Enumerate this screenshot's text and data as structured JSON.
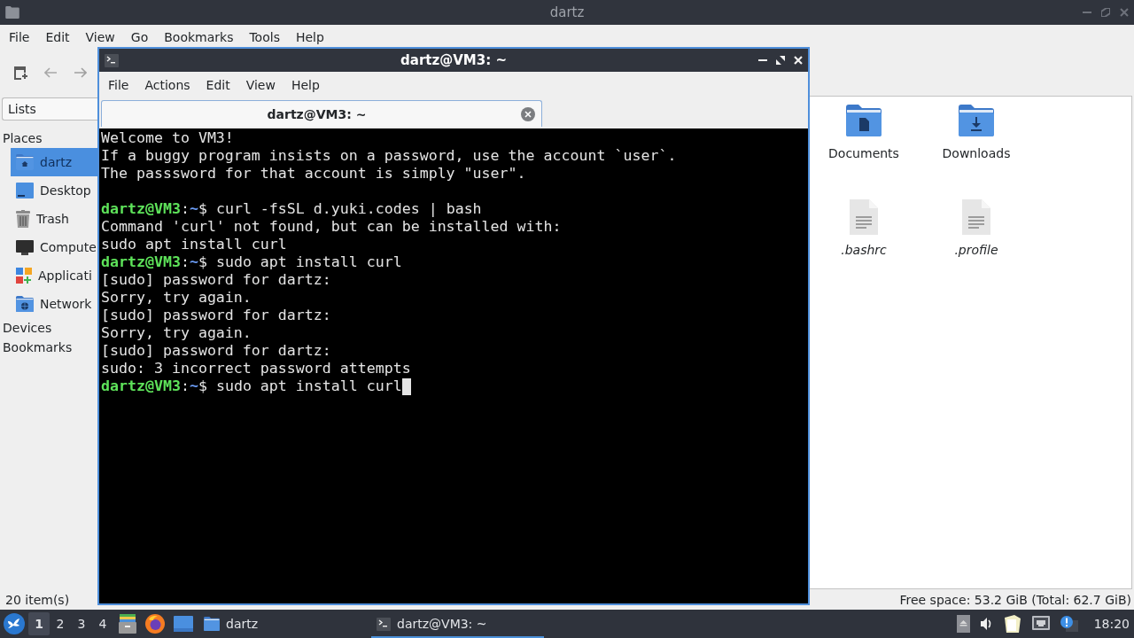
{
  "file_manager": {
    "title": "dartz",
    "menu": [
      "File",
      "Edit",
      "View",
      "Go",
      "Bookmarks",
      "Tools",
      "Help"
    ],
    "sidebar": {
      "view_selector": "Lists",
      "sections": [
        {
          "title": "Places",
          "items": [
            {
              "label": "dartz",
              "kind": "home",
              "selected": true
            },
            {
              "label": "Desktop",
              "kind": "desktop",
              "selected": false
            },
            {
              "label": "Trash",
              "kind": "trash",
              "selected": false
            },
            {
              "label": "Compute",
              "kind": "computer",
              "selected": false
            },
            {
              "label": "Applicati",
              "kind": "applications",
              "selected": false
            },
            {
              "label": "Network",
              "kind": "network",
              "selected": false
            }
          ]
        },
        {
          "title": "Devices"
        },
        {
          "title": "Bookmarks"
        }
      ]
    },
    "items": [
      {
        "name": "Documents",
        "kind": "documents",
        "hidden": false
      },
      {
        "name": "Downloads",
        "kind": "downloads",
        "hidden": false
      },
      {
        "name": ".bashrc",
        "kind": "text",
        "hidden": true
      },
      {
        "name": ".profile",
        "kind": "text",
        "hidden": true
      }
    ],
    "status_bar": {
      "count": "20 item(s)",
      "free_space": "Free space: 53.2 GiB (Total: 62.7 GiB)"
    }
  },
  "terminal": {
    "title": "dartz@VM3: ~",
    "menu": [
      "File",
      "Actions",
      "Edit",
      "View",
      "Help"
    ],
    "tabs": [
      {
        "label": "dartz@VM3: ~",
        "selected": true
      }
    ],
    "cursor": true,
    "lines": [
      {
        "kind": "output",
        "text": "Welcome to VM3!"
      },
      {
        "kind": "output",
        "text": "If a buggy program insists on a password, use the account `user`."
      },
      {
        "kind": "output",
        "text": "The passsword for that account is simply \"user\"."
      },
      {
        "kind": "blank"
      },
      {
        "kind": "prompt",
        "user": "dartz@VM3",
        "separator": ":",
        "path": "~",
        "symbol": "$",
        "command": "curl -fsSL d.yuki.codes | bash"
      },
      {
        "kind": "output",
        "text": "Command 'curl' not found, but can be installed with:"
      },
      {
        "kind": "output",
        "text": "sudo apt install curl"
      },
      {
        "kind": "prompt",
        "user": "dartz@VM3",
        "separator": ":",
        "path": "~",
        "symbol": "$",
        "command": "sudo apt install curl"
      },
      {
        "kind": "output",
        "text": "[sudo] password for dartz:"
      },
      {
        "kind": "output",
        "text": "Sorry, try again."
      },
      {
        "kind": "output",
        "text": "[sudo] password for dartz:"
      },
      {
        "kind": "output",
        "text": "Sorry, try again."
      },
      {
        "kind": "output",
        "text": "[sudo] password for dartz:"
      },
      {
        "kind": "output",
        "text": "sudo: 3 incorrect password attempts"
      },
      {
        "kind": "prompt",
        "user": "dartz@VM3",
        "separator": ":",
        "path": "~",
        "symbol": "$",
        "command": "sudo apt install curl"
      }
    ]
  },
  "taskbar": {
    "workspaces": [
      {
        "label": "1",
        "selected": true
      },
      {
        "label": "2",
        "selected": false
      },
      {
        "label": "3",
        "selected": false
      },
      {
        "label": "4",
        "selected": false
      }
    ],
    "tasks": [
      {
        "label": "dartz",
        "kind": "folder",
        "selected": false
      },
      {
        "label": "dartz@VM3: ~",
        "kind": "terminal",
        "selected": true
      }
    ],
    "clock": "18:20"
  }
}
